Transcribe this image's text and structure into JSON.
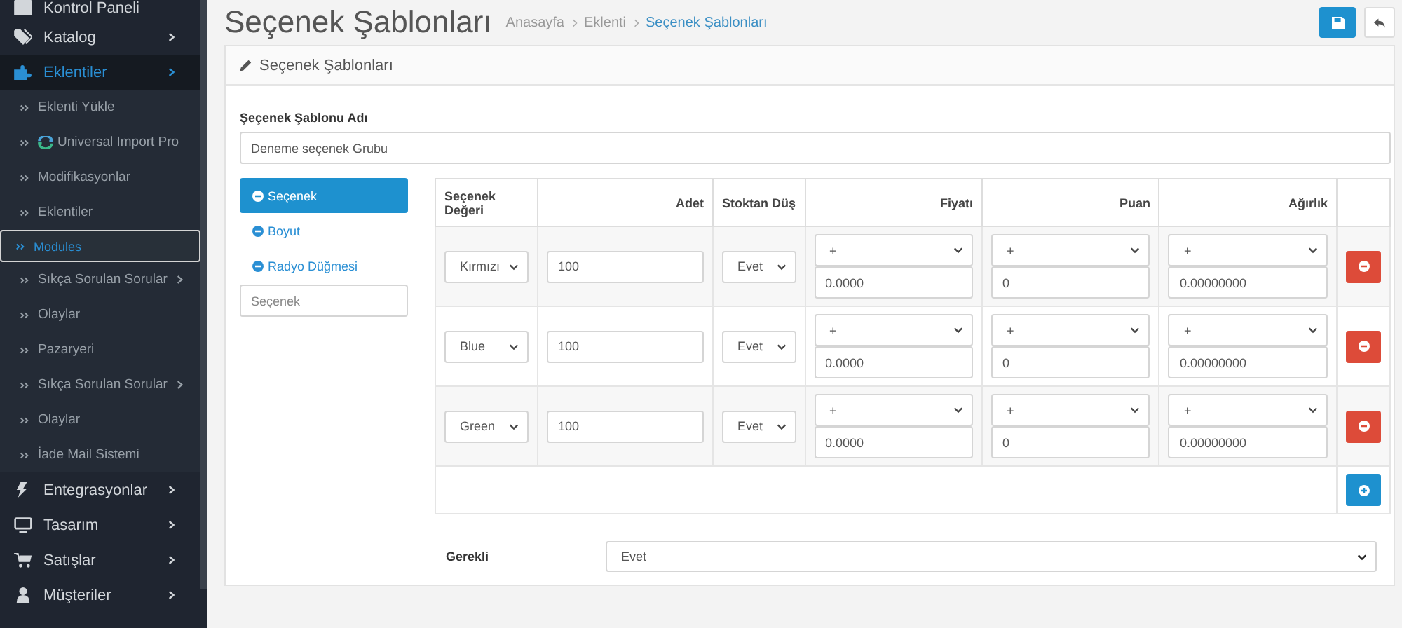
{
  "sidebar": {
    "items": [
      {
        "label": "Kontrol Paneli"
      },
      {
        "label": "Katalog",
        "expanded": false
      },
      {
        "label": "Eklentiler",
        "expanded": true,
        "children": [
          {
            "label": "Eklenti Yükle",
            "selected": false
          },
          {
            "label": "Universal Import Pro",
            "selected": false
          },
          {
            "label": "Modifikasyonlar",
            "selected": false
          },
          {
            "label": "Eklentiler",
            "selected": false
          },
          {
            "label": "Modules",
            "selected": true
          },
          {
            "label": "Sıkça Sorulan Sorular",
            "selected": false,
            "expanded": false
          },
          {
            "label": "Olaylar",
            "selected": false
          },
          {
            "label": "Pazaryeri",
            "selected": false
          },
          {
            "label": "Sıkça Sorulan Sorular",
            "selected": false,
            "expanded": false
          },
          {
            "label": "Olaylar",
            "selected": false
          },
          {
            "label": "İade Mail Sistemi",
            "selected": false
          }
        ]
      },
      {
        "label": "Entegrasyonlar",
        "expanded": false
      },
      {
        "label": "Tasarım",
        "expanded": false
      },
      {
        "label": "Satışlar",
        "expanded": false
      },
      {
        "label": "Müşteriler",
        "expanded": false
      }
    ]
  },
  "header": {
    "title": "Seçenek Şablonları",
    "breadcrumb": [
      "Anasayfa",
      "Eklenti",
      "Seçenek Şablonları"
    ]
  },
  "panel": {
    "title": "Seçenek Şablonları",
    "name_field": {
      "label": "Şeçenek Şablonu Adı",
      "value": "Deneme seçenek Grubu"
    },
    "option_types": [
      {
        "label": "Seçenek",
        "selected": true
      },
      {
        "label": "Boyut",
        "selected": false
      },
      {
        "label": "Radyo Düğmesi",
        "selected": false
      }
    ],
    "new_option": {
      "placeholder": "Seçenek"
    },
    "table": {
      "columns": [
        "Seçenek Değeri",
        "Adet",
        "Stoktan Düş",
        "Fiyatı",
        "Puan",
        "Ağırlık"
      ],
      "rows": [
        {
          "value": "Kırmızı",
          "quantity": "100",
          "subtract": "Evet",
          "price_prefix": "+",
          "price": "0.0000",
          "points_prefix": "+",
          "points": "0",
          "weight_prefix": "+",
          "weight": "0.00000000"
        },
        {
          "value": "Blue",
          "quantity": "100",
          "subtract": "Evet",
          "price_prefix": "+",
          "price": "0.0000",
          "points_prefix": "+",
          "points": "0",
          "weight_prefix": "+",
          "weight": "0.00000000"
        },
        {
          "value": "Green",
          "quantity": "100",
          "subtract": "Evet",
          "price_prefix": "+",
          "price": "0.0000",
          "points_prefix": "+",
          "points": "0",
          "weight_prefix": "+",
          "weight": "0.00000000"
        }
      ]
    },
    "required": {
      "label": "Gerekli",
      "value": "Evet"
    }
  }
}
